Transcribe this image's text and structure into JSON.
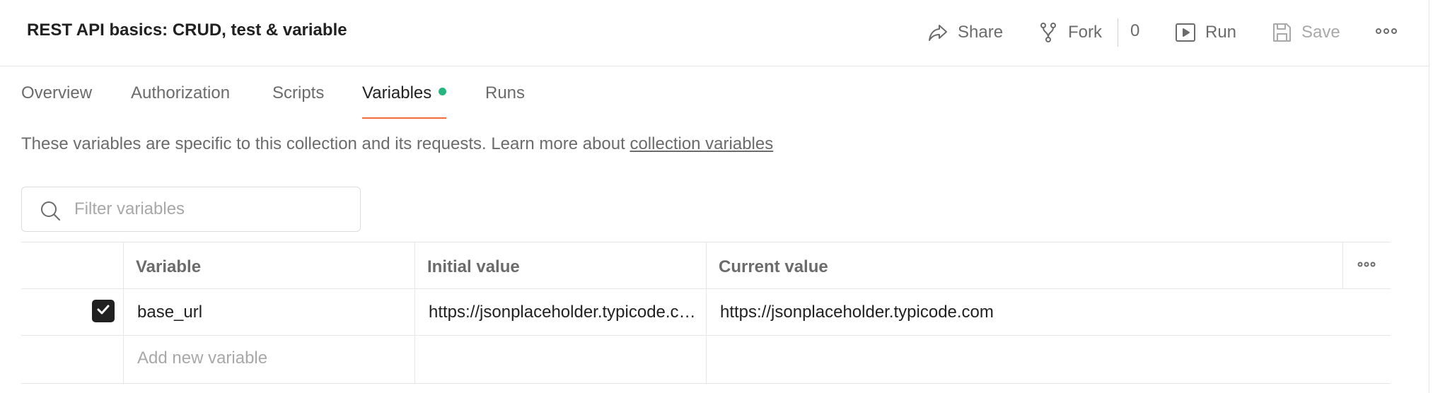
{
  "header": {
    "title": "REST API basics: CRUD, test & variable",
    "share_label": "Share",
    "fork_label": "Fork",
    "fork_count": "0",
    "run_label": "Run",
    "save_label": "Save"
  },
  "tabs": [
    {
      "label": "Overview",
      "active": false
    },
    {
      "label": "Authorization",
      "active": false
    },
    {
      "label": "Scripts",
      "active": false
    },
    {
      "label": "Variables",
      "active": true,
      "indicator_color": "#26b47f"
    },
    {
      "label": "Runs",
      "active": false
    }
  ],
  "description": {
    "text": "These variables are specific to this collection and its requests. Learn more about ",
    "link": "collection variables"
  },
  "filter": {
    "placeholder": "Filter variables"
  },
  "table": {
    "columns": [
      "Variable",
      "Initial value",
      "Current value"
    ],
    "rows": [
      {
        "enabled": true,
        "variable": "base_url",
        "initial_value": "https://jsonplaceholder.typicode.com",
        "current_value": "https://jsonplaceholder.typicode.com"
      }
    ],
    "new_row_placeholder": "Add new variable"
  },
  "colors": {
    "accent": "#f26b3a",
    "active_dot": "#26b47f",
    "checkbox": "#212121"
  },
  "icons": [
    "share-icon",
    "fork-icon",
    "run-icon",
    "save-icon",
    "more-icon",
    "search-icon",
    "check-icon"
  ]
}
